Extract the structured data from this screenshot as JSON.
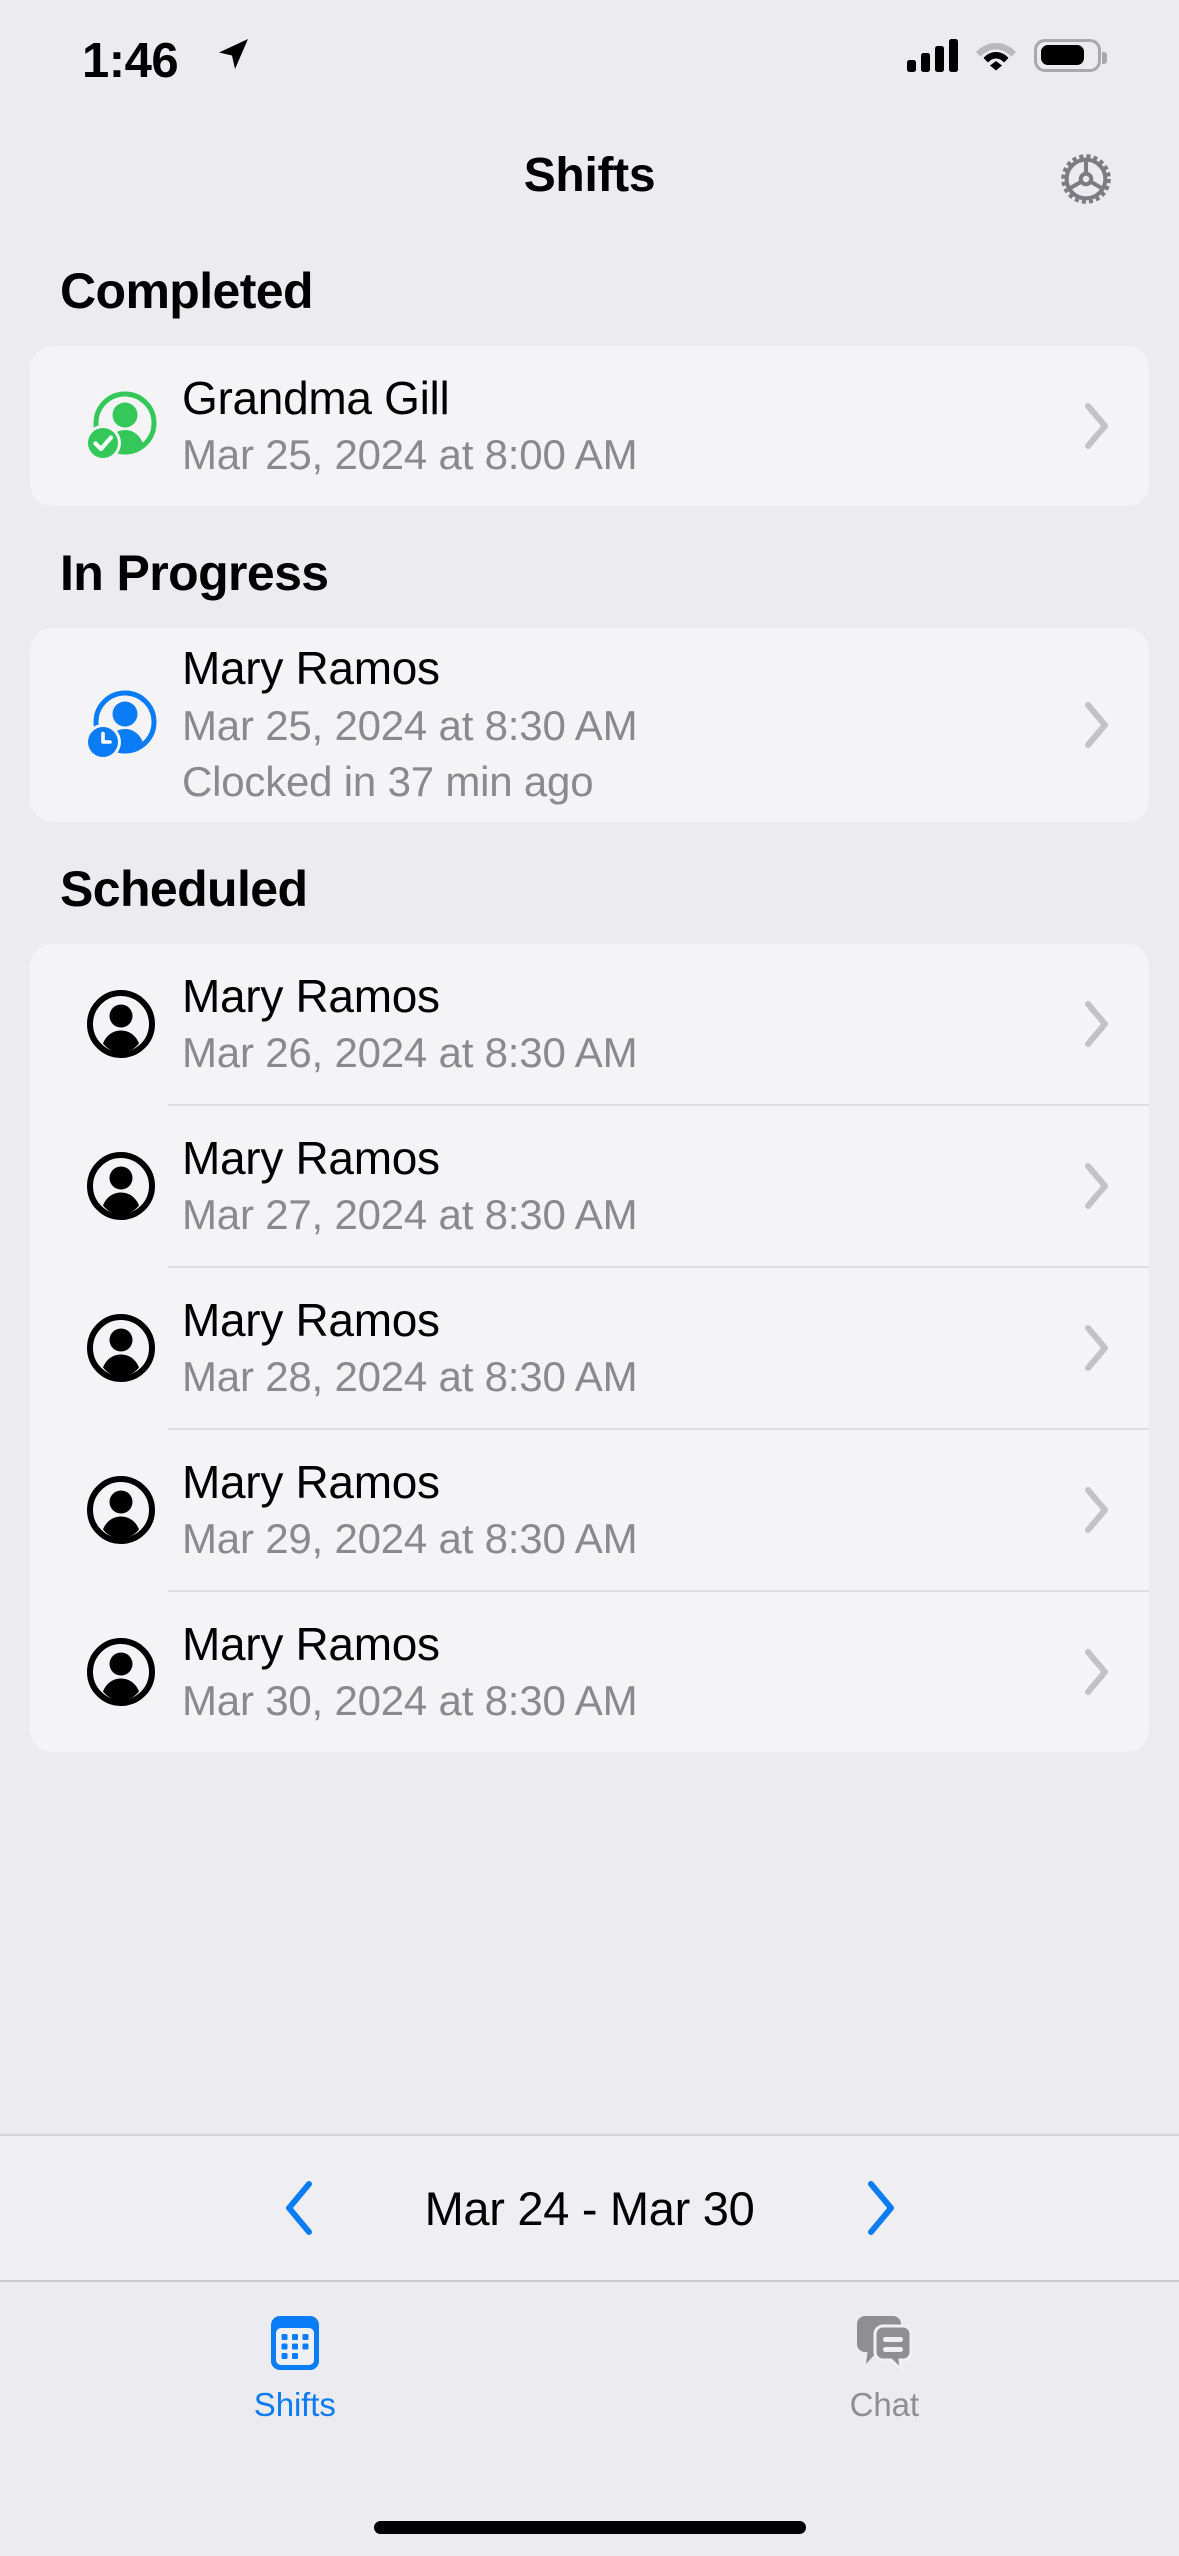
{
  "status_bar": {
    "time": "1:46",
    "location_icon": "location-arrow-icon",
    "cellular_icon": "cellular-bars-icon",
    "wifi_icon": "wifi-icon",
    "battery_icon": "battery-icon"
  },
  "nav": {
    "title": "Shifts",
    "settings_icon": "gear-icon"
  },
  "sections": [
    {
      "heading": "Completed",
      "rows": [
        {
          "icon": "person-check-icon",
          "icon_color": "#34c759",
          "title": "Grandma Gill",
          "subtitle": "Mar 25, 2024 at 8:00 AM",
          "detail": "",
          "chevron": "chevron-right-icon"
        }
      ]
    },
    {
      "heading": "In Progress",
      "rows": [
        {
          "icon": "person-clock-icon",
          "icon_color": "#0a7cf6",
          "title": "Mary Ramos",
          "subtitle": "Mar 25, 2024 at 8:30 AM",
          "detail": "Clocked in 37 min ago",
          "chevron": "chevron-right-icon"
        }
      ]
    },
    {
      "heading": "Scheduled",
      "rows": [
        {
          "icon": "person-circle-icon",
          "icon_color": "#000000",
          "title": "Mary Ramos",
          "subtitle": "Mar 26, 2024 at 8:30 AM",
          "detail": "",
          "chevron": "chevron-right-icon"
        },
        {
          "icon": "person-circle-icon",
          "icon_color": "#000000",
          "title": "Mary Ramos",
          "subtitle": "Mar 27, 2024 at 8:30 AM",
          "detail": "",
          "chevron": "chevron-right-icon"
        },
        {
          "icon": "person-circle-icon",
          "icon_color": "#000000",
          "title": "Mary Ramos",
          "subtitle": "Mar 28, 2024 at 8:30 AM",
          "detail": "",
          "chevron": "chevron-right-icon"
        },
        {
          "icon": "person-circle-icon",
          "icon_color": "#000000",
          "title": "Mary Ramos",
          "subtitle": "Mar 29, 2024 at 8:30 AM",
          "detail": "",
          "chevron": "chevron-right-icon"
        },
        {
          "icon": "person-circle-icon",
          "icon_color": "#000000",
          "title": "Mary Ramos",
          "subtitle": "Mar 30, 2024 at 8:30 AM",
          "detail": "",
          "chevron": "chevron-right-icon"
        }
      ]
    }
  ],
  "date_nav": {
    "prev_icon": "chevron-left-icon",
    "range": "Mar 24 - Mar 30",
    "next_icon": "chevron-right-icon"
  },
  "tabs": [
    {
      "label": "Shifts",
      "icon": "calendar-icon",
      "active": true
    },
    {
      "label": "Chat",
      "icon": "chat-bubbles-icon",
      "active": false
    }
  ],
  "colors": {
    "accent": "#0a7cf6",
    "completed": "#34c759",
    "background": "#ebebf0",
    "card": "#f4f4f6",
    "secondary_text": "#8a8a8e",
    "inactive_tab": "#8e8e93"
  }
}
